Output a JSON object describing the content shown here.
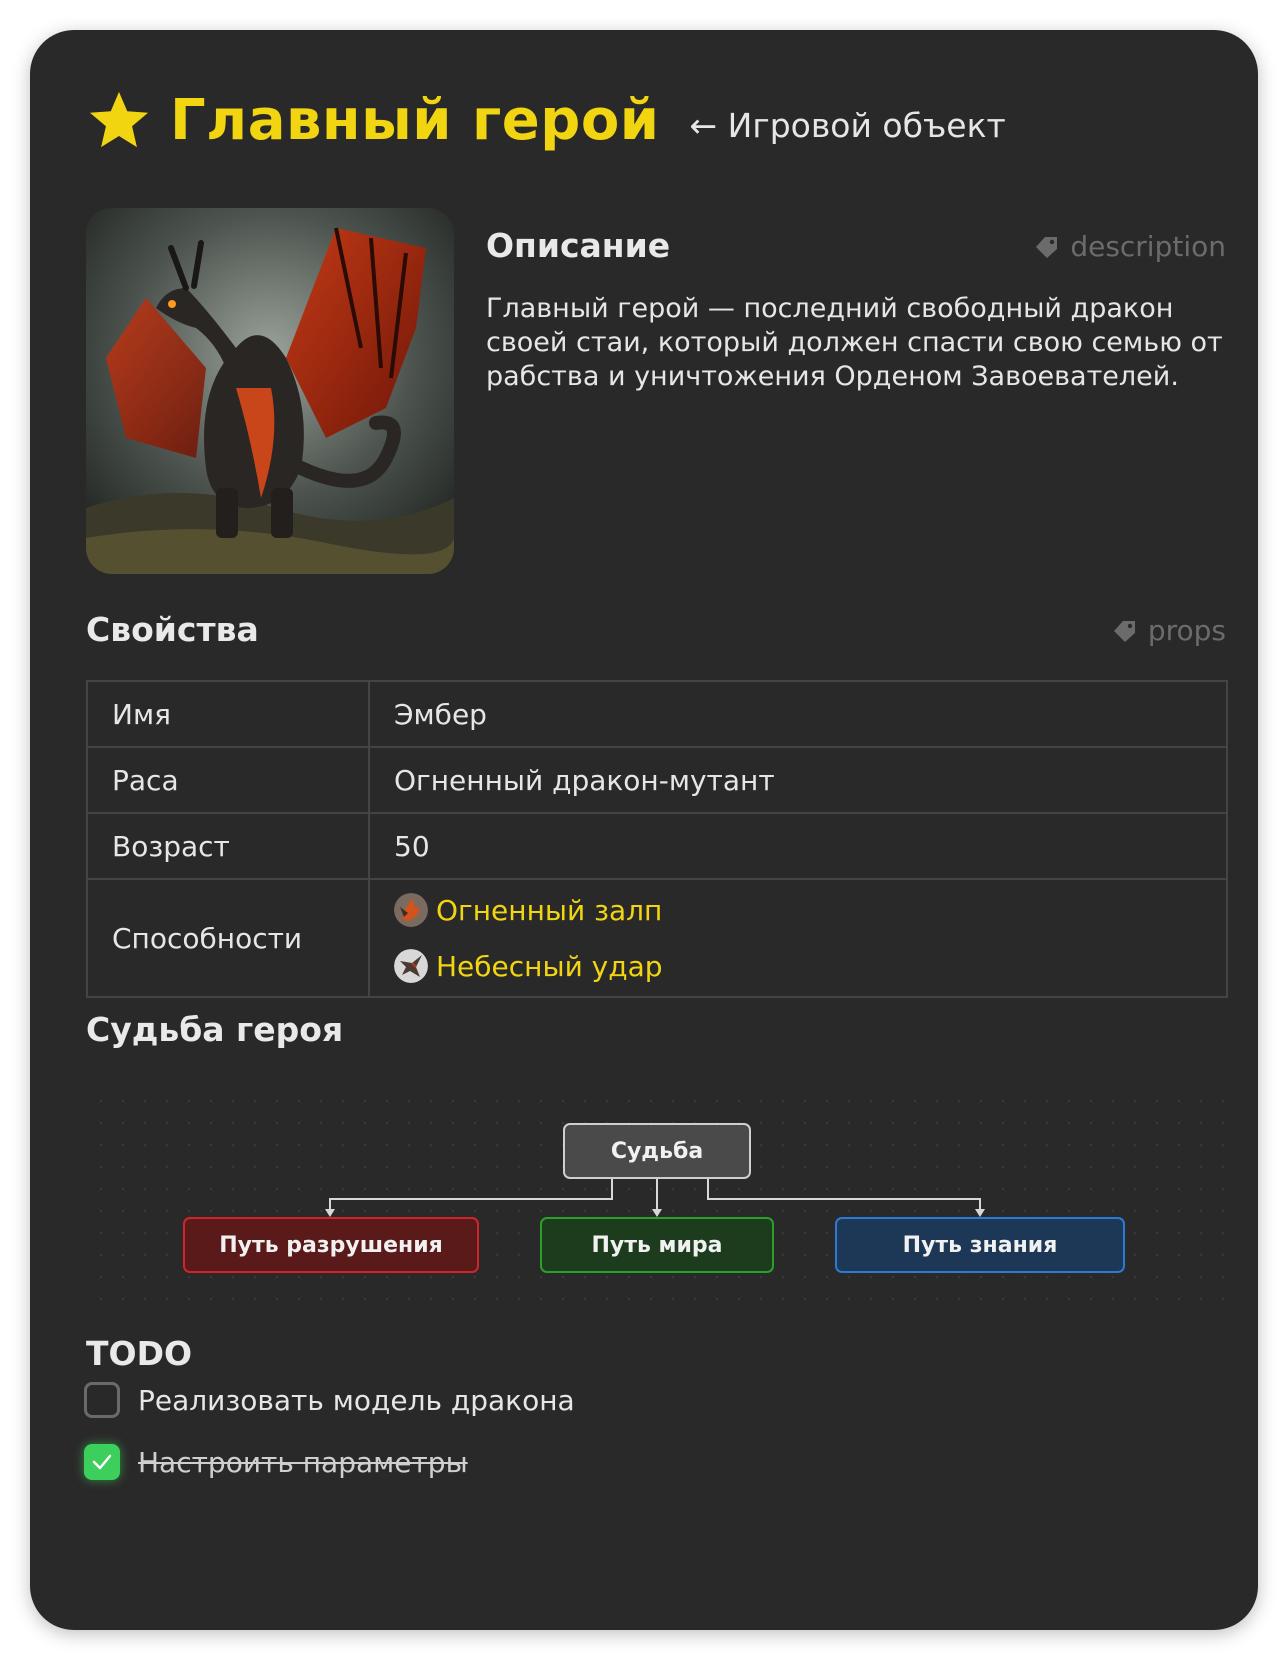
{
  "header": {
    "title": "Главный герой",
    "subtitle": "← Игровой объект",
    "icon": "star-icon",
    "accent_color": "#f2d511"
  },
  "description": {
    "heading": "Описание",
    "tag": "description",
    "text": "Главный герой — последний свободный дракон своей стаи, который должен спасти свою семью от рабства и уничтожения Орденом Завоевателей."
  },
  "props": {
    "heading": "Свойства",
    "tag": "props",
    "rows": [
      {
        "key": "Имя",
        "value": "Эмбер"
      },
      {
        "key": "Раса",
        "value": "Огненный дракон-мутант"
      },
      {
        "key": "Возраст",
        "value": "50"
      },
      {
        "key": "Способности",
        "abilities": [
          "Огненный залп",
          "Небесный удар"
        ]
      }
    ]
  },
  "fate": {
    "heading": "Судьба героя",
    "root": "Судьба",
    "branches": [
      {
        "label": "Путь разрушения",
        "color": "#d0262a"
      },
      {
        "label": "Путь мира",
        "color": "#2aa02a"
      },
      {
        "label": "Путь знания",
        "color": "#2a7ad6"
      }
    ]
  },
  "todo": {
    "heading": "TODO",
    "items": [
      {
        "label": "Реализовать модель дракона",
        "done": false
      },
      {
        "label": "Настроить параметры",
        "done": true
      }
    ]
  }
}
